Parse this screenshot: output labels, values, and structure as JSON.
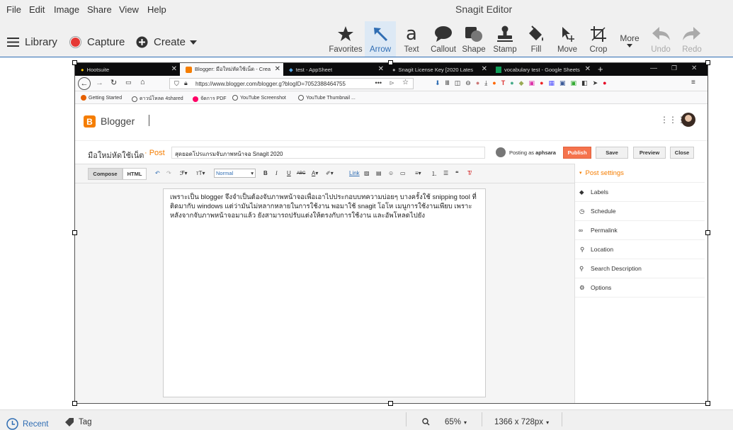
{
  "menu": {
    "items": [
      "File",
      "Edit",
      "Image",
      "Share",
      "View",
      "Help"
    ],
    "app_title": "Snagit Editor"
  },
  "toolbar": {
    "library": "Library",
    "capture": "Capture",
    "create": "Create",
    "tools": [
      {
        "label": "Favorites",
        "icon": "star-icon"
      },
      {
        "label": "Arrow",
        "icon": "arrow-icon"
      },
      {
        "label": "Text",
        "icon": "text-icon",
        "glyph": "a"
      },
      {
        "label": "Callout",
        "icon": "callout-icon"
      },
      {
        "label": "Shape",
        "icon": "shape-icon"
      },
      {
        "label": "Stamp",
        "icon": "stamp-icon"
      },
      {
        "label": "Fill",
        "icon": "fill-icon"
      },
      {
        "label": "Move",
        "icon": "move-icon"
      },
      {
        "label": "Crop",
        "icon": "crop-icon"
      },
      {
        "label": "More",
        "icon": "more-icon"
      },
      {
        "label": "Undo",
        "icon": "undo-icon"
      },
      {
        "label": "Redo",
        "icon": "redo-icon"
      }
    ],
    "colors": {
      "accent": "#2f6db3",
      "capture_red": "#e53935"
    }
  },
  "screenshot": {
    "tabs": [
      "Hootsuite",
      "Blogger: มือใหม่หัดใช้เน็ต - Crea",
      "test - AppSheet",
      "Snagit License Key [2020 Lates",
      "vocabulary test - Google Sheets"
    ],
    "url": "https://www.blogger.com/blogger.g?blogID=7052388464755",
    "bookmarks": [
      "Getting Started",
      "ดาวน์โหลด 4shared",
      "จัดการ PDF",
      "YouTube Screenshot",
      "YouTube Thumbnail ..."
    ],
    "blogger": {
      "brand": "Blogger",
      "blog_name": "มือใหม่หัดใช้เน็ต",
      "post_word": "· Post",
      "post_title": "สุดยอดโปรแกรมจับภาพหน้าจอ Snagit 2020",
      "posting_as_prefix": "Posting as",
      "posting_as_user": "aphsara",
      "buttons": {
        "publish": "Publish",
        "save": "Save",
        "preview": "Preview",
        "close": "Close"
      },
      "compose": "Compose",
      "html": "HTML",
      "font_size": "Normal",
      "link": "Link",
      "body_text": "เพราะเป็น blogger จึงจำเป็นต้องจับภาพหน้าจอเพื่อเอาไปประกอบบทความบ่อยๆ  บางครั้งใช้ snipping tool  ที่ติดมากับ windows แต่ว่ามันไม่หลากหลายในการใช้งาน พอมาใช้ snagit โอโห เมนูการใช้งานเพียบ  เพราะหลังจากจับภาพหน้าจอมาแล้ว  ยังสามารถปรับแต่งให้ตรงกับการใช้งาน และอัพโหลดไปยัง",
      "post_settings": "Post settings",
      "settings": [
        "Labels",
        "Schedule",
        "Permalink",
        "Location",
        "Search Description",
        "Options"
      ],
      "colors": {
        "blogger_orange": "#f57d00",
        "publish": "#f5734d"
      }
    }
  },
  "status": {
    "recent": "Recent",
    "tag": "Tag",
    "zoom": "65%",
    "dimensions": "1366 x 728px"
  }
}
